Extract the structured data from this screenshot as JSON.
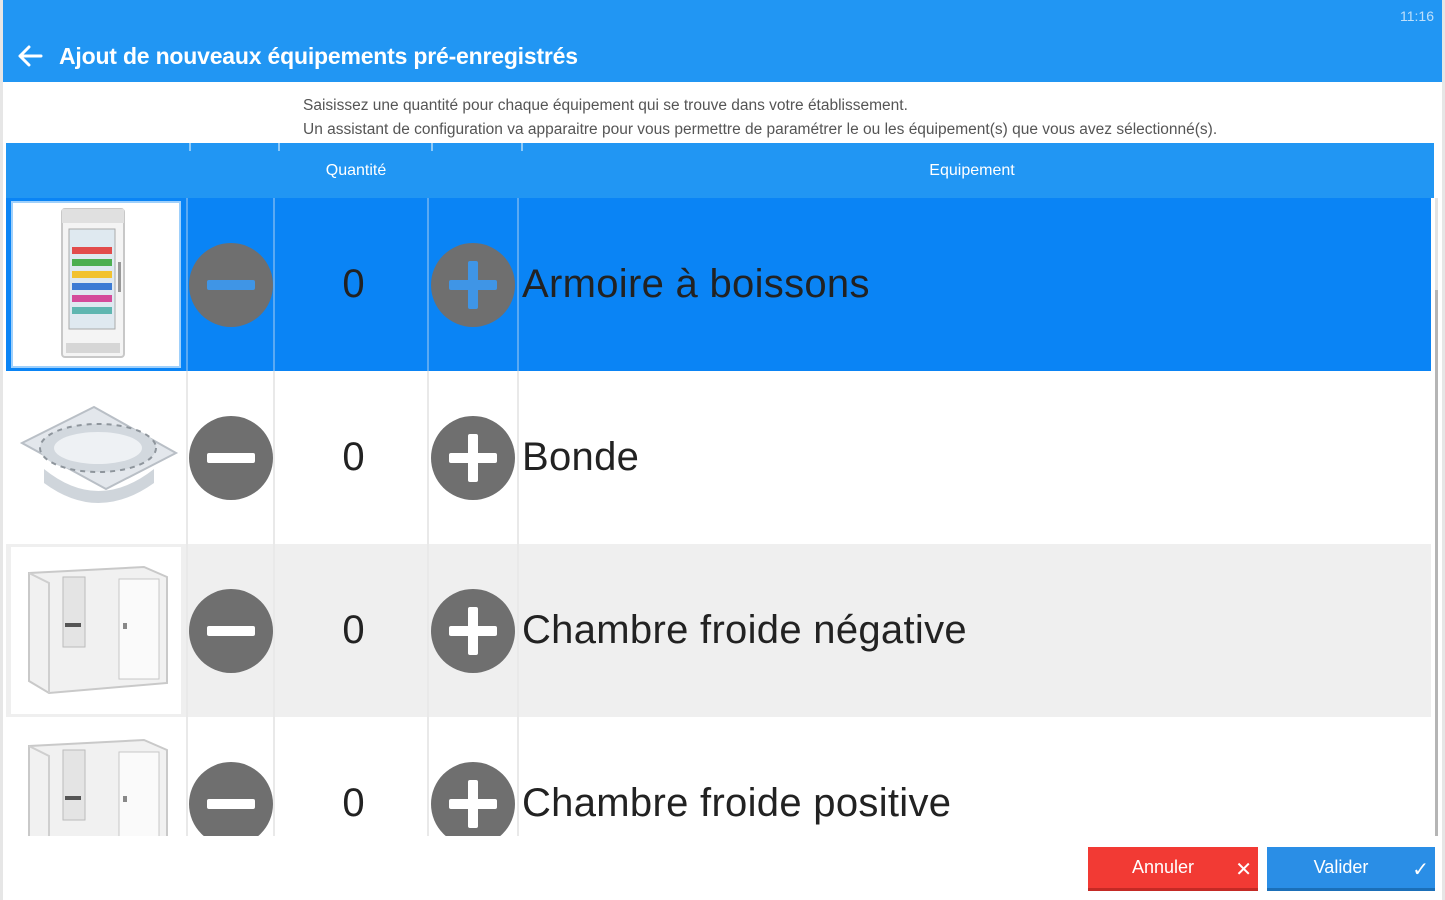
{
  "status": {
    "time": "11:16"
  },
  "appbar": {
    "title": "Ajout de nouveaux équipements pré-enregistrés",
    "back_icon": "arrow-left-icon"
  },
  "instructions": {
    "line1": "Saisissez une quantité pour chaque équipement qui se trouve dans votre établissement.",
    "line2": "Un assistant de configuration va apparaitre pour vous permettre de paramétrer le ou les équipement(s) que vous avez sélectionné(s)."
  },
  "table": {
    "headers": {
      "quantity": "Quantité",
      "equipment": "Equipement"
    },
    "rows": [
      {
        "image": "drinks-fridge-image",
        "quantity": "0",
        "name": "Armoire à boissons",
        "selected": true
      },
      {
        "image": "floor-drain-image",
        "quantity": "0",
        "name": "Bonde",
        "selected": false
      },
      {
        "image": "cold-room-image",
        "quantity": "0",
        "name": "Chambre froide négative",
        "selected": false
      },
      {
        "image": "cold-room-image",
        "quantity": "0",
        "name": "Chambre froide positive",
        "selected": false
      }
    ]
  },
  "footer": {
    "cancel_label": "Annuler",
    "cancel_icon_glyph": "✕",
    "ok_label": "Valider",
    "ok_icon_glyph": "✓"
  },
  "colors": {
    "primary": "#2196f3",
    "selected_row": "#0a84f5",
    "cancel": "#f23a34",
    "ok": "#2a8ee6"
  }
}
